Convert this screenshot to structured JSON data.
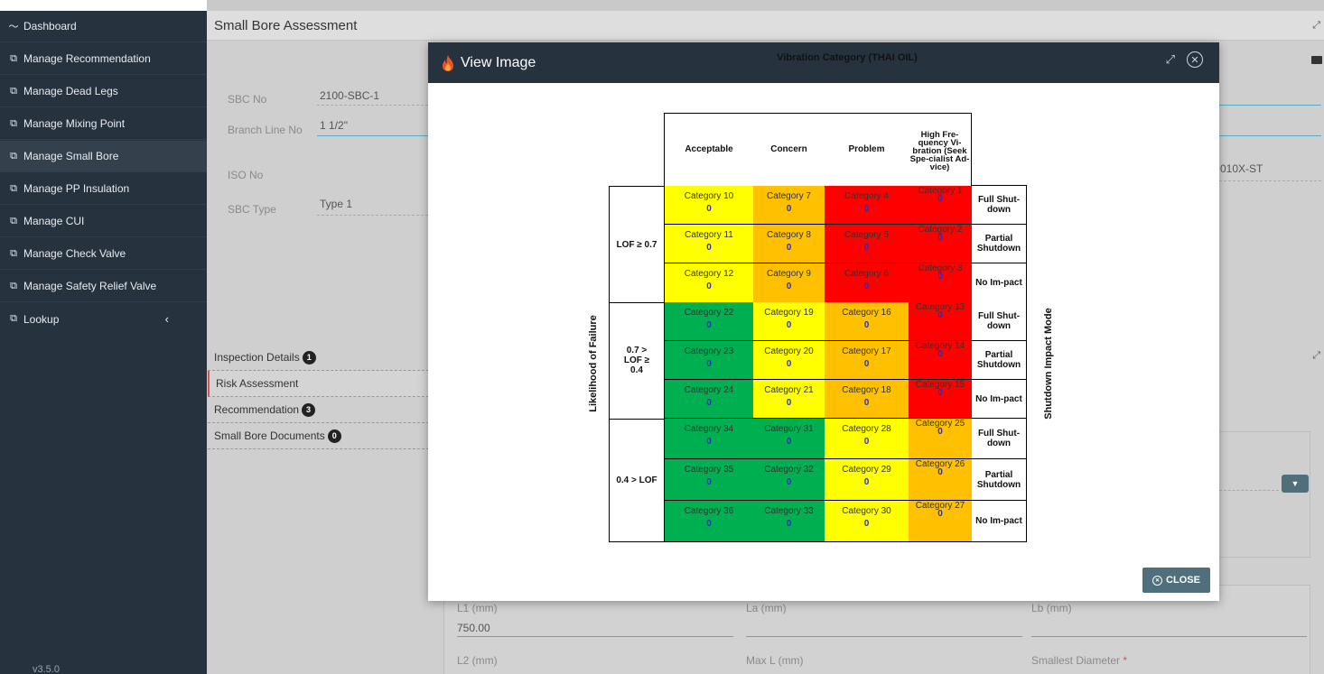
{
  "sidebar": {
    "items": [
      {
        "label": "Dashboard",
        "icon": "chart-line-icon"
      },
      {
        "label": "Manage Recommendation",
        "icon": "layers-icon"
      },
      {
        "label": "Manage Dead Legs",
        "icon": "layers-icon"
      },
      {
        "label": "Manage Mixing Point",
        "icon": "layers-icon"
      },
      {
        "label": "Manage Small Bore",
        "icon": "layers-icon"
      },
      {
        "label": "Manage PP Insulation",
        "icon": "layers-icon"
      },
      {
        "label": "Manage CUI",
        "icon": "layers-icon"
      },
      {
        "label": "Manage Check Valve",
        "icon": "layers-icon"
      },
      {
        "label": "Manage Safety Relief Valve",
        "icon": "layers-icon"
      },
      {
        "label": "Lookup",
        "icon": "layers-icon"
      }
    ],
    "version": "v3.5.0"
  },
  "main": {
    "title": "Small Bore Assessment",
    "form": {
      "sbc_no_label": "SBC No",
      "sbc_no_value": "2100-SBC-1",
      "branch_label": "Branch Line No",
      "branch_value": "1 1/2\"",
      "iso_label": "ISO No",
      "iso_value": "010X-ST",
      "type_label": "SBC Type",
      "type_value": "Type 1"
    },
    "tabs": [
      {
        "label": "Inspection Details",
        "badge": "1"
      },
      {
        "label": "Risk Assessment",
        "badge": ""
      },
      {
        "label": "Recommendation",
        "badge": "3"
      },
      {
        "label": "Small Bore Documents",
        "badge": "0"
      }
    ],
    "bottom_fields": {
      "l1_label": "L1 (mm)",
      "l1_value": "750.00",
      "la_label": "La (mm)",
      "lb_label": "Lb (mm)",
      "l2_label": "L2 (mm)",
      "maxl_label": "Max L (mm)",
      "smallest_label": "Smallest Diameter",
      "required_mark": "*"
    }
  },
  "modal": {
    "title": "View Image",
    "close_label": "CLOSE",
    "matrix": {
      "title": "Vibration Category (THAI OIL)",
      "columns": [
        "Acceptable",
        "Concern",
        "Problem",
        "High Fre-quency Vi-bration (Seek Spe-cialist Ad-vice)"
      ],
      "lof_groups": [
        "LOF ≥ 0.7",
        "0.7 > LOF ≥ 0.4",
        "0.4 > LOF"
      ],
      "impacts": [
        "Full Shut-down",
        "Partial Shutdown",
        "No Im-pact"
      ],
      "y_axis": "Likelihood of Failure",
      "right_axis": "Shutdown Impact Mode",
      "rows": [
        {
          "cells": [
            {
              "c": "Category 10",
              "v": "0",
              "color": "#ffff00"
            },
            {
              "c": "Category 7",
              "v": "0",
              "color": "#ffc000"
            },
            {
              "c": "Category 4",
              "v": "0",
              "color": "#ff0000"
            },
            {
              "c": "Category 1",
              "v": "0",
              "color": "#ff0000"
            }
          ]
        },
        {
          "cells": [
            {
              "c": "Category 11",
              "v": "0",
              "color": "#ffff00"
            },
            {
              "c": "Category 8",
              "v": "0",
              "color": "#ffc000"
            },
            {
              "c": "Category 5",
              "v": "0",
              "color": "#ff0000"
            },
            {
              "c": "Category 2",
              "v": "0",
              "color": "#ff0000"
            }
          ]
        },
        {
          "cells": [
            {
              "c": "Category 12",
              "v": "0",
              "color": "#ffff00"
            },
            {
              "c": "Category 9",
              "v": "0",
              "color": "#ffc000"
            },
            {
              "c": "Category 6",
              "v": "0",
              "color": "#ff0000"
            },
            {
              "c": "Category 3",
              "v": "0",
              "color": "#ff0000"
            }
          ]
        },
        {
          "cells": [
            {
              "c": "Category 22",
              "v": "0",
              "color": "#00b050"
            },
            {
              "c": "Category 19",
              "v": "0",
              "color": "#ffff00"
            },
            {
              "c": "Category 16",
              "v": "0",
              "color": "#ffc000"
            },
            {
              "c": "Category 13",
              "v": "0",
              "color": "#ff0000"
            }
          ]
        },
        {
          "cells": [
            {
              "c": "Category 23",
              "v": "0",
              "color": "#00b050"
            },
            {
              "c": "Category 20",
              "v": "0",
              "color": "#ffff00"
            },
            {
              "c": "Category 17",
              "v": "0",
              "color": "#ffc000"
            },
            {
              "c": "Category 14",
              "v": "0",
              "color": "#ff0000"
            }
          ]
        },
        {
          "cells": [
            {
              "c": "Category 24",
              "v": "0",
              "color": "#00b050"
            },
            {
              "c": "Category 21",
              "v": "0",
              "color": "#ffff00"
            },
            {
              "c": "Category 18",
              "v": "0",
              "color": "#ffc000"
            },
            {
              "c": "Category 15",
              "v": "0",
              "color": "#ff0000"
            }
          ]
        },
        {
          "cells": [
            {
              "c": "Category 34",
              "v": "0",
              "color": "#00b050"
            },
            {
              "c": "Category 31",
              "v": "0",
              "color": "#00b050"
            },
            {
              "c": "Category 28",
              "v": "0",
              "color": "#ffff00"
            },
            {
              "c": "Category 25",
              "v": "0",
              "color": "#ffc000"
            }
          ]
        },
        {
          "cells": [
            {
              "c": "Category 35",
              "v": "0",
              "color": "#00b050"
            },
            {
              "c": "Category 32",
              "v": "0",
              "color": "#00b050"
            },
            {
              "c": "Category 29",
              "v": "0",
              "color": "#ffff00"
            },
            {
              "c": "Category 26",
              "v": "0",
              "color": "#ffc000"
            }
          ]
        },
        {
          "cells": [
            {
              "c": "Category 36",
              "v": "0",
              "color": "#00b050"
            },
            {
              "c": "Category 33",
              "v": "0",
              "color": "#00b050"
            },
            {
              "c": "Category 30",
              "v": "0",
              "color": "#ffff00"
            },
            {
              "c": "Category 27",
              "v": "0",
              "color": "#ffc000"
            }
          ]
        }
      ]
    }
  }
}
